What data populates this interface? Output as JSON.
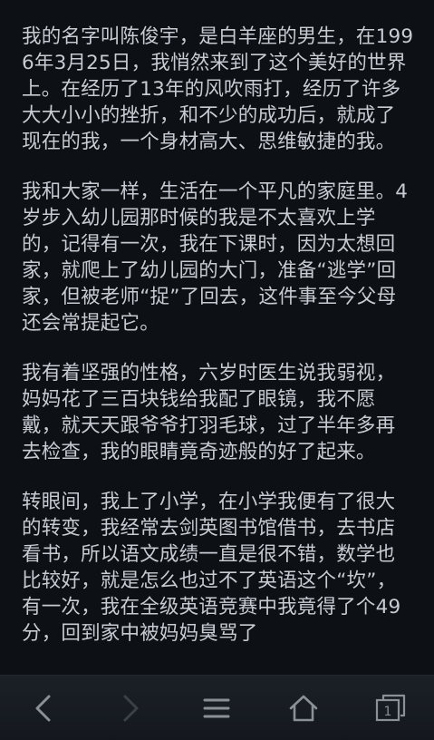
{
  "article": {
    "paragraphs": [
      "我的名字叫陈俊宇，是白羊座的男生，在1996年3月25日，我悄然来到了这个美好的世界上。在经历了13年的风吹雨打，经历了许多大大小小的挫折，和不少的成功后，就成了现在的我，一个身材高大、思维敏捷的我。",
      "我和大家一样，生活在一个平凡的家庭里。4岁步入幼儿园那时候的我是不太喜欢上学的，记得有一次，我在下课时，因为太想回家，就爬上了幼儿园的大门，准备“逃学”回家，但被老师“捉”了回去，这件事至今父母还会常提起它。",
      "我有着坚强的性格，六岁时医生说我弱视，妈妈花了三百块钱给我配了眼镜，我不愿戴，就天天跟爷爷打羽毛球，过了半年多再去检查，我的眼睛竟奇迹般的好了起来。",
      "转眼间，我上了小学，在小学我便有了很大的转变，我经常去剑英图书馆借书，去书店看书，所以语文成绩一直是很不错，数学也比较好，就是怎么也过不了英语这个“坎”，有一次，我在全级英语竞赛中我竟得了个49分，回到家中被妈妈臭骂了"
    ]
  },
  "bottom_nav": {
    "tab_count": "1",
    "icons": [
      "back-arrow-icon",
      "forward-arrow-icon",
      "menu-icon",
      "home-icon",
      "tabs-icon"
    ],
    "colors": {
      "enabled": "#8a9097",
      "disabled": "#3b4047",
      "background": "#171b21",
      "page_background": "#0d1116",
      "text": "#c7ccd2"
    }
  }
}
